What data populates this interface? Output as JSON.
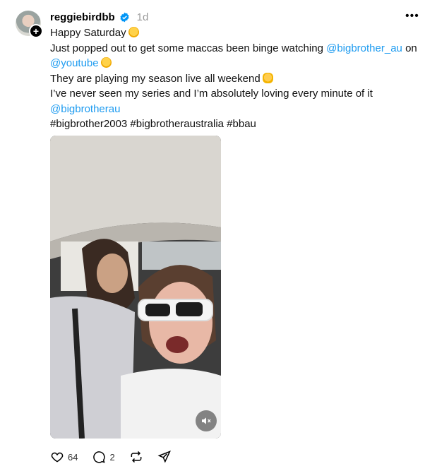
{
  "post": {
    "username": "reggiebirdbb",
    "time": "1d",
    "lines": [
      "Happy Saturday",
      "Just popped out to get some maccas been binge watching",
      "on",
      "They are playing my season live all weekend",
      "I’ve never seen my series and I’m absolutely loving every minute of it",
      "#bigbrother2003 #bigbrotheraustralia #bbau"
    ],
    "mentions": [
      "@bigbrother_au",
      "@youtube",
      "@bigbrotherau"
    ]
  },
  "actions": {
    "likes": "64",
    "replies": "2"
  },
  "colors": {
    "link": "#1d9bf0",
    "verified": "#0095f6",
    "muted_text": "#999999"
  },
  "icons": [
    "plus-icon",
    "verified-icon",
    "more-icon",
    "hug-emoji",
    "ok-hand-emoji",
    "mute-icon",
    "heart-icon",
    "comment-icon",
    "repost-icon",
    "share-icon"
  ]
}
